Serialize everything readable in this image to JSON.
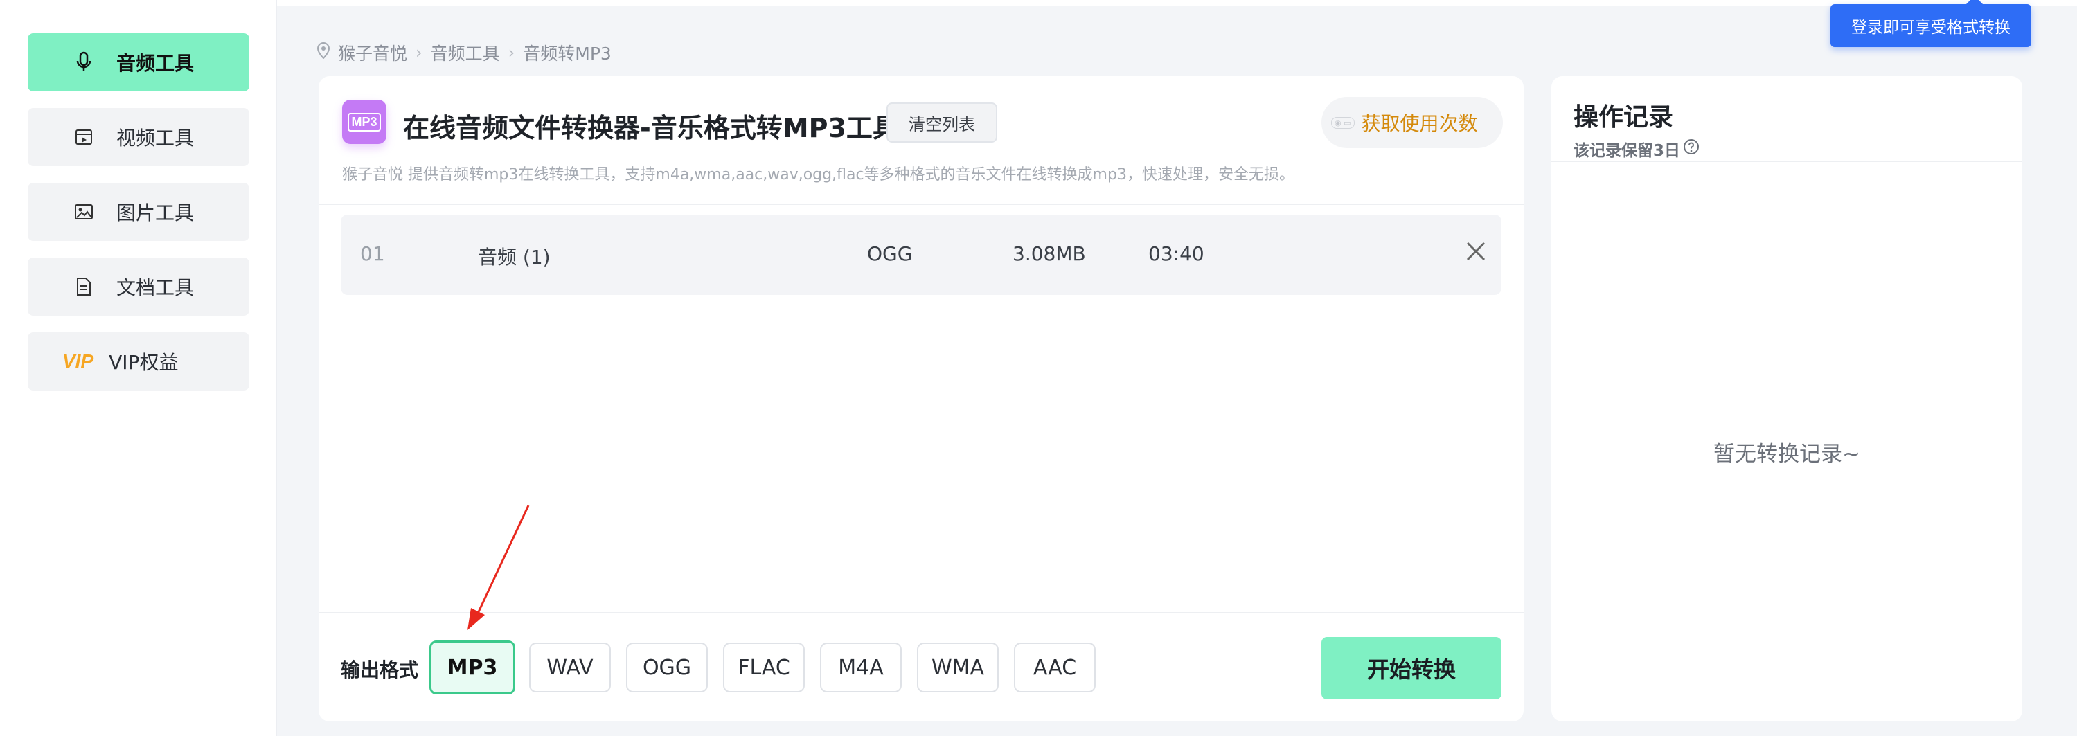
{
  "sidebar": {
    "items": [
      {
        "label": "音频工具",
        "icon": "microphone-icon",
        "active": true
      },
      {
        "label": "视频工具",
        "icon": "video-icon"
      },
      {
        "label": "图片工具",
        "icon": "image-icon"
      },
      {
        "label": "文档工具",
        "icon": "document-icon"
      },
      {
        "label": "VIP权益",
        "icon": "vip-icon",
        "badge": "VIP"
      }
    ]
  },
  "breadcrumb": [
    "猴子音悦",
    "音频工具",
    "音频转MP3"
  ],
  "login_tip": "登录即可享受格式转换",
  "main": {
    "app_icon_text": "MP3",
    "title": "在线音频文件转换器-音乐格式转MP3工具",
    "clear_label": "清空列表",
    "usage_label": "获取使用次数",
    "description": "猴子音悦 提供音频转mp3在线转换工具，支持m4a,wma,aac,wav,ogg,flac等多种格式的音乐文件在线转换成mp3，快速处理，安全无损。",
    "files": [
      {
        "index": "01",
        "name": "音频 (1)",
        "format": "OGG",
        "size": "3.08MB",
        "duration": "03:40"
      }
    ],
    "output_label": "输出格式",
    "formats": [
      "MP3",
      "WAV",
      "OGG",
      "FLAC",
      "M4A",
      "WMA",
      "AAC"
    ],
    "selected_format": "MP3",
    "start_label": "开始转换"
  },
  "records": {
    "title": "操作记录",
    "subtitle": "该记录保留3日",
    "empty": "暂无转换记录~"
  },
  "colors": {
    "accent_green": "#7ff0c3",
    "selected_border": "#3bc98b",
    "tooltip_blue": "#2e6df6",
    "app_icon_purple": "#c47af5",
    "usage_orange": "#d4890a",
    "arrow_red": "#e8281e"
  }
}
